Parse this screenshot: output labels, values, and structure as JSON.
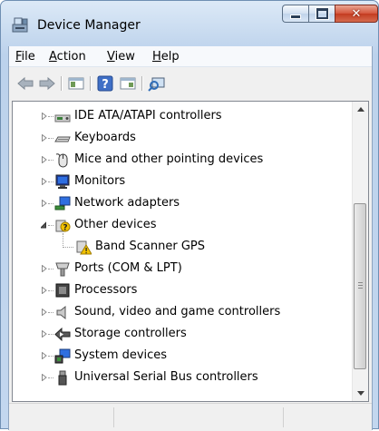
{
  "window": {
    "title": "Device Manager"
  },
  "menu": [
    {
      "label": "File",
      "mnemonic": "F",
      "rest": "ile"
    },
    {
      "label": "Action",
      "mnemonic": "A",
      "rest": "ction"
    },
    {
      "label": "View",
      "mnemonic": "V",
      "rest": "iew"
    },
    {
      "label": "Help",
      "mnemonic": "H",
      "rest": "elp"
    }
  ],
  "toolbar": [
    "back-arrow-icon",
    "forward-arrow-icon",
    "show-hide-console-tree-icon",
    "help-icon",
    "properties-icon",
    "scan-hardware-icon"
  ],
  "tree": {
    "items": [
      {
        "label": "IDE ATA/ATAPI controllers",
        "icon": "ide-controller-icon",
        "expanded": false
      },
      {
        "label": "Keyboards",
        "icon": "keyboard-icon",
        "expanded": false
      },
      {
        "label": "Mice and other pointing devices",
        "icon": "mouse-icon",
        "expanded": false
      },
      {
        "label": "Monitors",
        "icon": "monitor-icon",
        "expanded": false
      },
      {
        "label": "Network adapters",
        "icon": "network-adapter-icon",
        "expanded": false
      },
      {
        "label": "Other devices",
        "icon": "unknown-device-icon",
        "expanded": true
      },
      {
        "label": "Band Scanner GPS",
        "icon": "warning-device-icon",
        "child": true
      },
      {
        "label": "Ports (COM & LPT)",
        "icon": "port-icon",
        "expanded": false
      },
      {
        "label": "Processors",
        "icon": "processor-icon",
        "expanded": false
      },
      {
        "label": "Sound, video and game controllers",
        "icon": "speaker-icon",
        "expanded": false
      },
      {
        "label": "Storage controllers",
        "icon": "storage-controller-icon",
        "expanded": false
      },
      {
        "label": "System devices",
        "icon": "system-devices-icon",
        "expanded": false
      },
      {
        "label": "Universal Serial Bus controllers",
        "icon": "usb-icon",
        "expanded": false
      }
    ]
  },
  "scroll": {
    "position": 0.62
  },
  "colors": {
    "accent": "#6f8fb3",
    "close": "#c33b20",
    "warning": "#f2c200"
  }
}
